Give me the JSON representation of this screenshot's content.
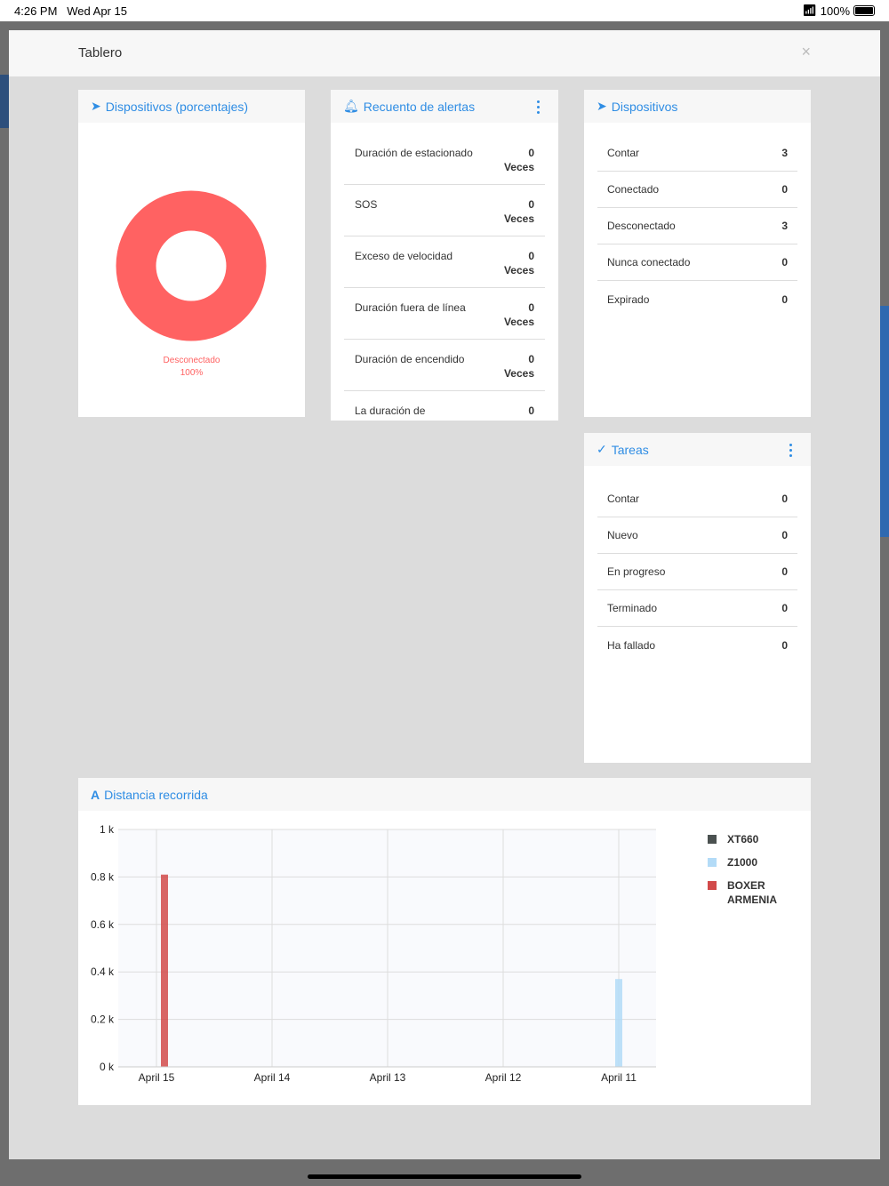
{
  "status": {
    "time": "4:26 PM",
    "date": "Wed Apr 15",
    "battery": "100%"
  },
  "modal": {
    "title": "Tablero",
    "close": "×"
  },
  "pie": {
    "title": "Dispositivos (porcentajes)",
    "label": "Desconectado",
    "percent_label": "100%",
    "percent": 100,
    "color": "#ff6262"
  },
  "alerts": {
    "title": "Recuento de alertas",
    "rows": [
      {
        "label": "Duración de estacionado",
        "value": "0",
        "unit": "Veces"
      },
      {
        "label": "SOS",
        "value": "0",
        "unit": "Veces"
      },
      {
        "label": "Exceso de velocidad",
        "value": "0",
        "unit": "Veces"
      },
      {
        "label": "Duración fuera de línea",
        "value": "0",
        "unit": "Veces"
      },
      {
        "label": "Duración de encendido",
        "value": "0",
        "unit": "Veces"
      },
      {
        "label": "La duración de",
        "value": "0",
        "unit": ""
      }
    ]
  },
  "devices": {
    "title": "Dispositivos",
    "rows": [
      {
        "label": "Contar",
        "value": "3"
      },
      {
        "label": "Conectado",
        "value": "0"
      },
      {
        "label": "Desconectado",
        "value": "3"
      },
      {
        "label": "Nunca conectado",
        "value": "0"
      },
      {
        "label": "Expirado",
        "value": "0"
      }
    ]
  },
  "tasks": {
    "title": "Tareas",
    "rows": [
      {
        "label": "Contar",
        "value": "0"
      },
      {
        "label": "Nuevo",
        "value": "0"
      },
      {
        "label": "En progreso",
        "value": "0"
      },
      {
        "label": "Terminado",
        "value": "0"
      },
      {
        "label": "Ha fallado",
        "value": "0"
      }
    ]
  },
  "chart_data": {
    "type": "bar",
    "title": "Distancia recorrida",
    "categories": [
      "April 15",
      "April 14",
      "April 13",
      "April 12",
      "April 11"
    ],
    "yticks": [
      "0 k",
      "0.2 k",
      "0.4 k",
      "0.6 k",
      "0.8 k",
      "1 k"
    ],
    "ylim": [
      0,
      1000
    ],
    "grid": true,
    "legend_position": "right",
    "series": [
      {
        "name": "XT660",
        "color": "#4a5150",
        "values": [
          0,
          0,
          0,
          0,
          0
        ]
      },
      {
        "name": "Z1000",
        "color": "#b3dbf7",
        "values": [
          0,
          0,
          0,
          0,
          370
        ]
      },
      {
        "name": "BOXER ARMENIA",
        "color": "#d24a4a",
        "values": [
          810,
          0,
          0,
          0,
          0
        ]
      }
    ]
  }
}
